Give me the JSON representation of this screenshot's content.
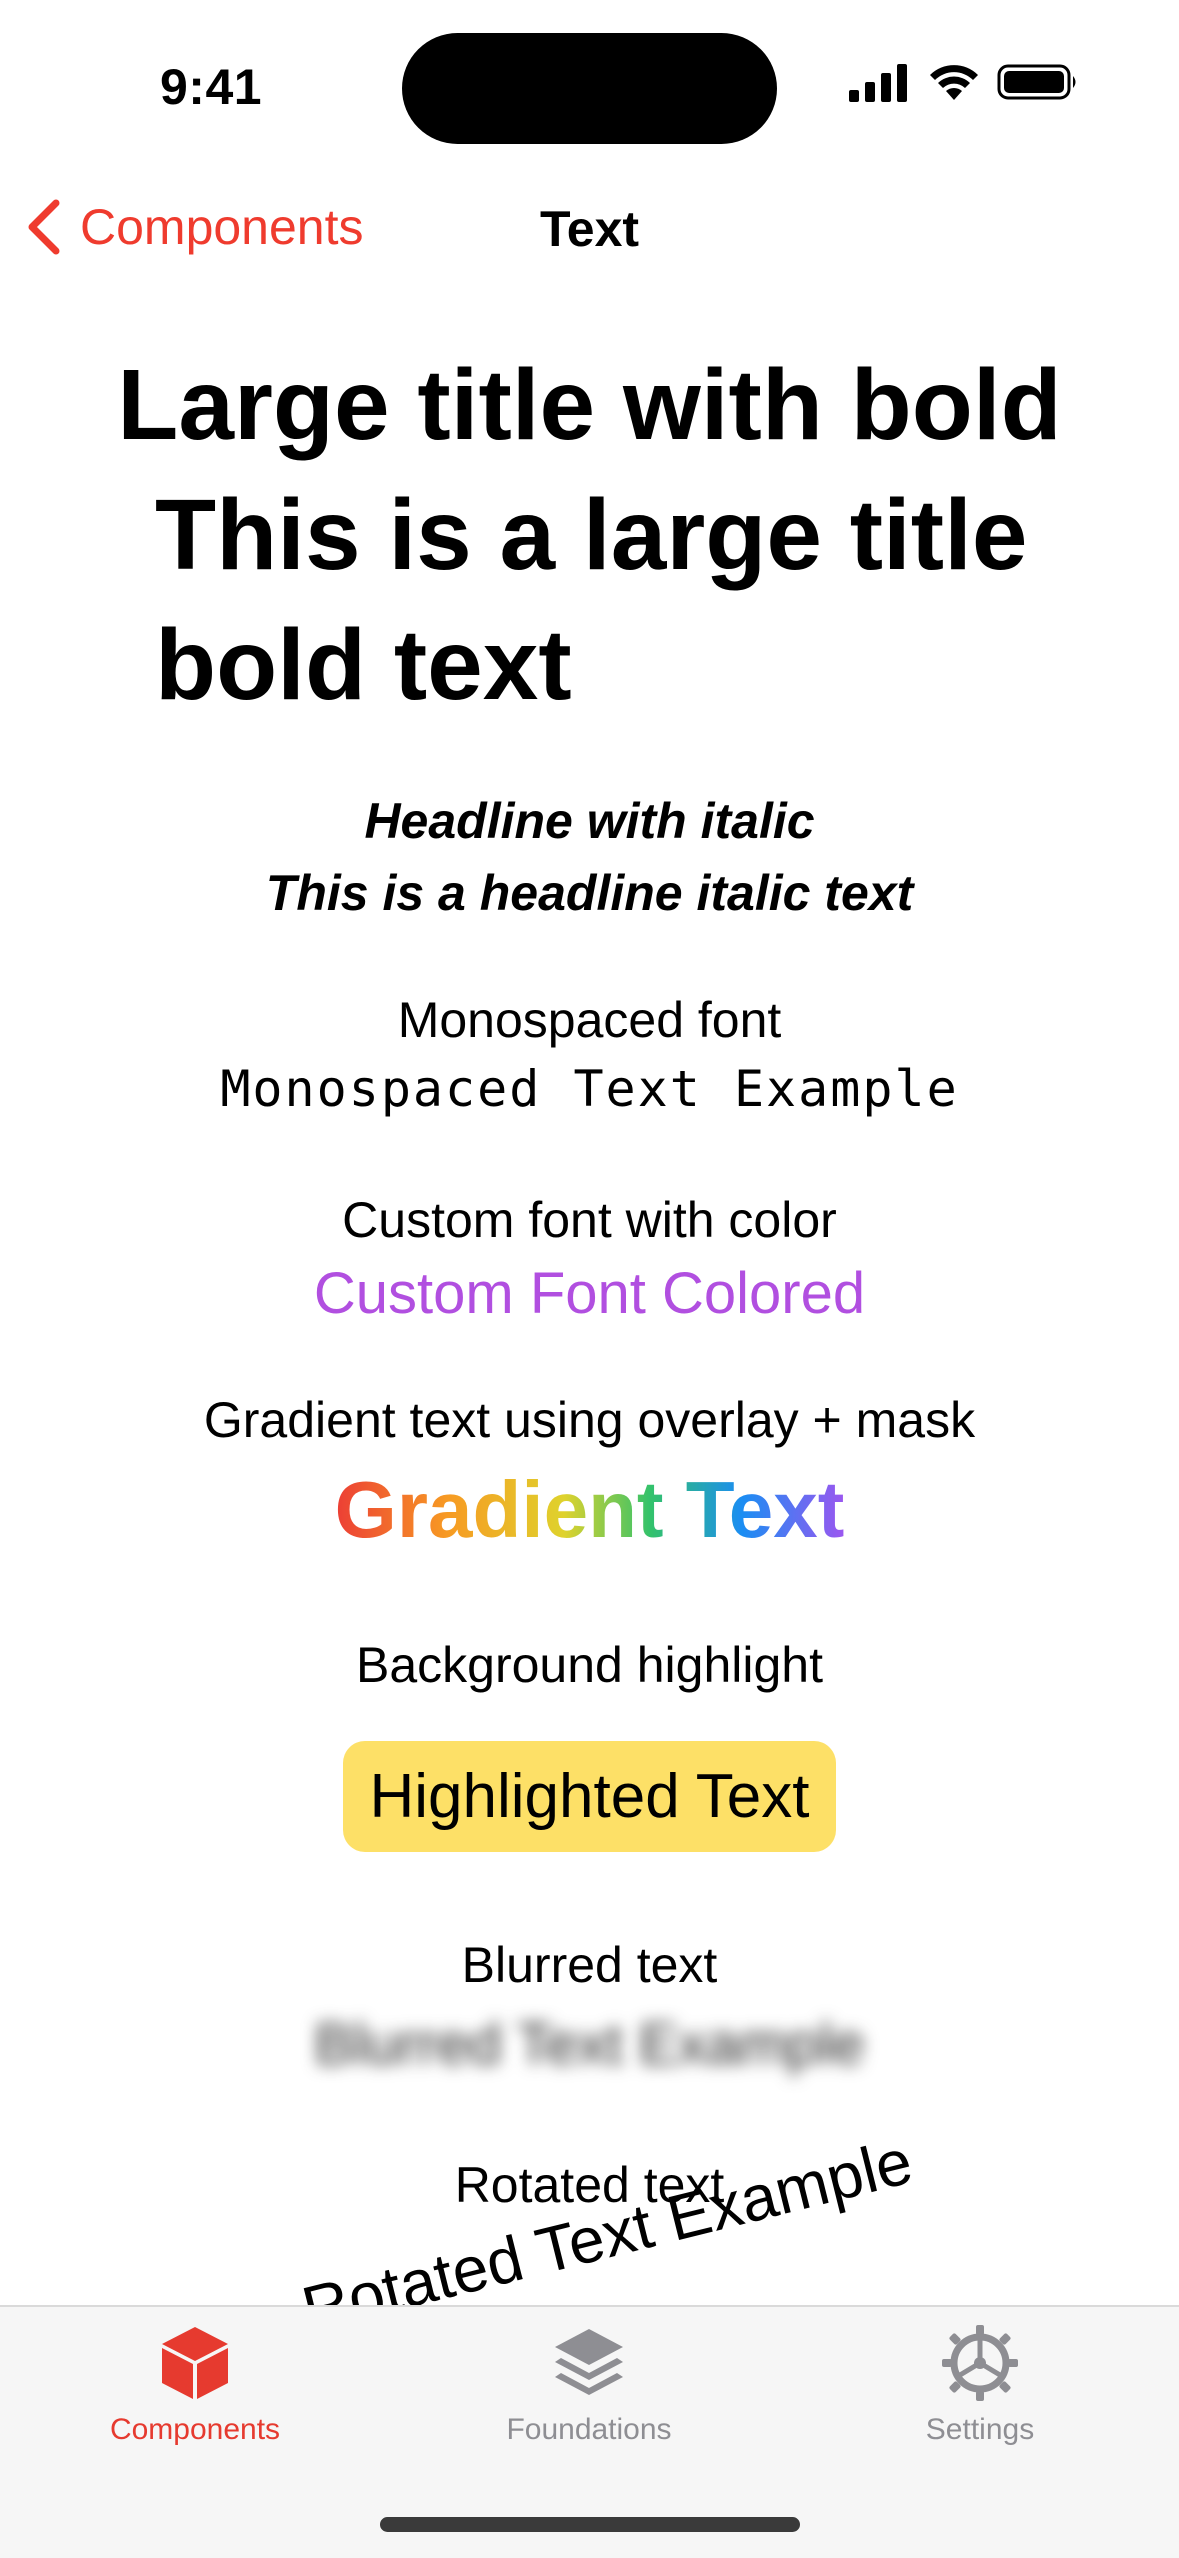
{
  "status_bar": {
    "time": "9:41"
  },
  "nav": {
    "back_label": "Components",
    "title": "Text"
  },
  "content": {
    "large_title": "Large title with bold",
    "large_title_body": "This is a large title bold text",
    "headline_label": "Headline with italic",
    "headline_text": "This is a headline italic text",
    "mono_label": "Monospaced font",
    "mono_text": "Monospaced Text Example",
    "custom_label": "Custom font with color",
    "custom_text": "Custom Font Colored",
    "custom_color": "#b14fe0",
    "gradient_label": "Gradient text using overlay + mask",
    "gradient_text": "Gradient Text",
    "highlight_label": "Background highlight",
    "highlight_text": "Highlighted Text",
    "highlight_color": "#fde067",
    "blur_label": "Blurred text",
    "blur_text": "Blurred Text Example",
    "rotated_label": "Rotated text",
    "rotated_text": "Rotated Text Example"
  },
  "tabbar": {
    "items": [
      {
        "label": "Components",
        "icon": "cube-icon",
        "active": true
      },
      {
        "label": "Foundations",
        "icon": "layers-icon",
        "active": false
      },
      {
        "label": "Settings",
        "icon": "gear-icon",
        "active": false
      }
    ],
    "accent": "#e63a2f",
    "inactive": "#8e8e93"
  }
}
